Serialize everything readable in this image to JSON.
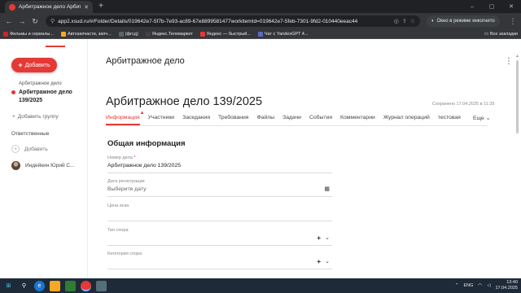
{
  "browser": {
    "tab_title": "Арбитражное дело Арбитраж",
    "tab_close": "✕",
    "new_tab": "+",
    "url": "app2.xsud.ru/#/Folder/Details/019642e7-5f7b-7e93-ac89-67e8899581477workitemId=019642e7-5feb-7301-9fd2-010440eeac44",
    "incognito_label": "Окно в режиме инкогнито",
    "window_controls": [
      "–",
      "▢",
      "✕"
    ],
    "bookmarks": [
      {
        "label": "Фильмы и сериалы...",
        "color": "#c62828"
      },
      {
        "label": "Автозапчасти, запч...",
        "color": "#f9a825"
      },
      {
        "label": "(фгсд)",
        "color": "#5f6368"
      },
      {
        "label": "Яндекс.Телемаркет",
        "color": "#424242"
      },
      {
        "label": "Яндекс — быстрый...",
        "color": "#e53935"
      },
      {
        "label": "Чат с YandexGPT 4...",
        "color": "#5c6bc0"
      }
    ],
    "all_bookmarks": "Все закладки"
  },
  "sidebar": {
    "add_button": "Добавить",
    "breadcrumb": "Арбитражное дело",
    "current_item": "Арбитражное дело 139/2025",
    "add_group": "Добавить группу",
    "responsible_title": "Ответственные",
    "responsible_add": "Добавить",
    "user_name": "Индейкин Юрий С..."
  },
  "main": {
    "header_title": "Арбитражное дело",
    "record_title": "Арбитражное дело 139/2025",
    "saved_text": "Сохранено 17.04.2025 в 11:39",
    "tabs": [
      "Информация",
      "Участники",
      "Заседания",
      "Требования",
      "Файлы",
      "Задачи",
      "События",
      "Комментарии",
      "Журнал операций",
      "тестовая"
    ],
    "active_tab": "Информация",
    "more_tab": "Еще",
    "section_title": "Общая информация",
    "fields": {
      "case_number": {
        "label": "Номер дела",
        "value": "Арбитражное дело 139/2025"
      },
      "reg_date": {
        "label": "Дата регистрации",
        "placeholder": "Выберите дату"
      },
      "claim_price": {
        "label": "Цена иска",
        "value": ""
      },
      "dispute_type": {
        "label": "Тип спора",
        "value": ""
      },
      "dispute_category": {
        "label": "Категория спора",
        "value": ""
      }
    }
  },
  "taskbar": {
    "lang": "ENG",
    "time": "13:40",
    "date": "17.04.2025"
  },
  "colors": {
    "accent": "#e53935",
    "taskbar": "#1f2a38",
    "chrome": "#35363a"
  }
}
